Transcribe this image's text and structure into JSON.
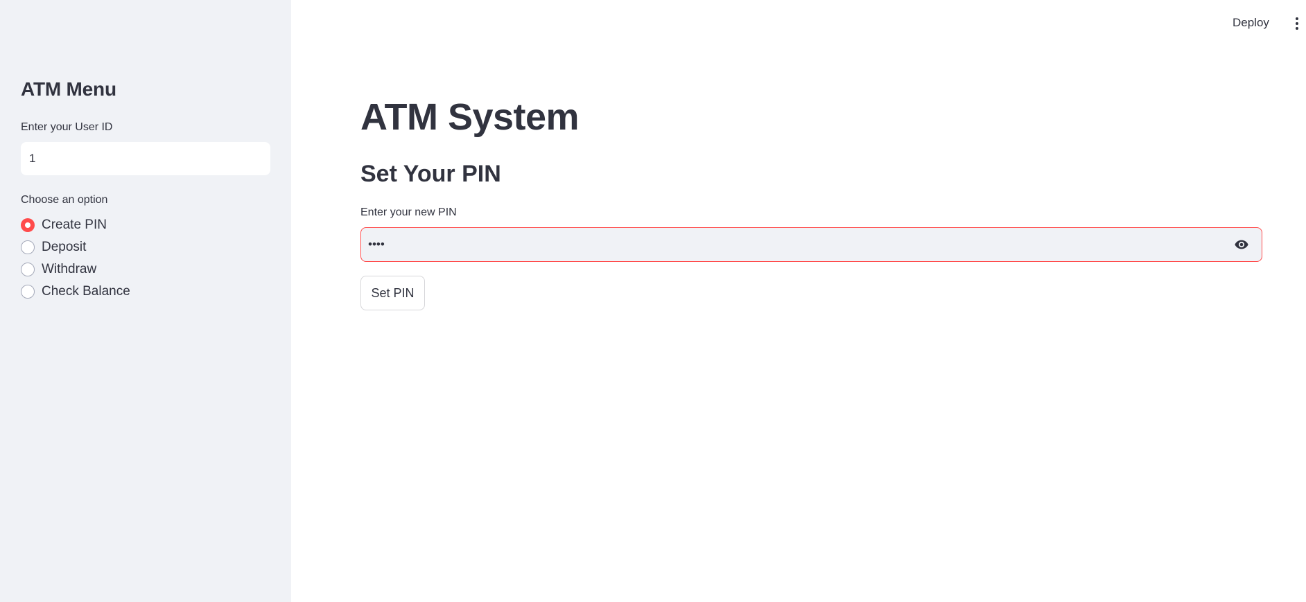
{
  "header": {
    "deploy_label": "Deploy",
    "menu_icon": "vertical-dots-icon"
  },
  "sidebar": {
    "title": "ATM Menu",
    "user_id_label": "Enter your User ID",
    "user_id_value": "1",
    "option_label": "Choose an option",
    "options": [
      {
        "label": "Create PIN",
        "selected": true
      },
      {
        "label": "Deposit",
        "selected": false
      },
      {
        "label": "Withdraw",
        "selected": false
      },
      {
        "label": "Check Balance",
        "selected": false
      }
    ]
  },
  "main": {
    "title": "ATM System",
    "subtitle": "Set Your PIN",
    "pin_label": "Enter your new PIN",
    "pin_value": "1234",
    "pin_icon": "eye-icon",
    "submit_label": "Set PIN"
  },
  "colors": {
    "accent": "#ff4b4b",
    "sidebar_bg": "#f0f2f6",
    "text": "#31333f"
  }
}
